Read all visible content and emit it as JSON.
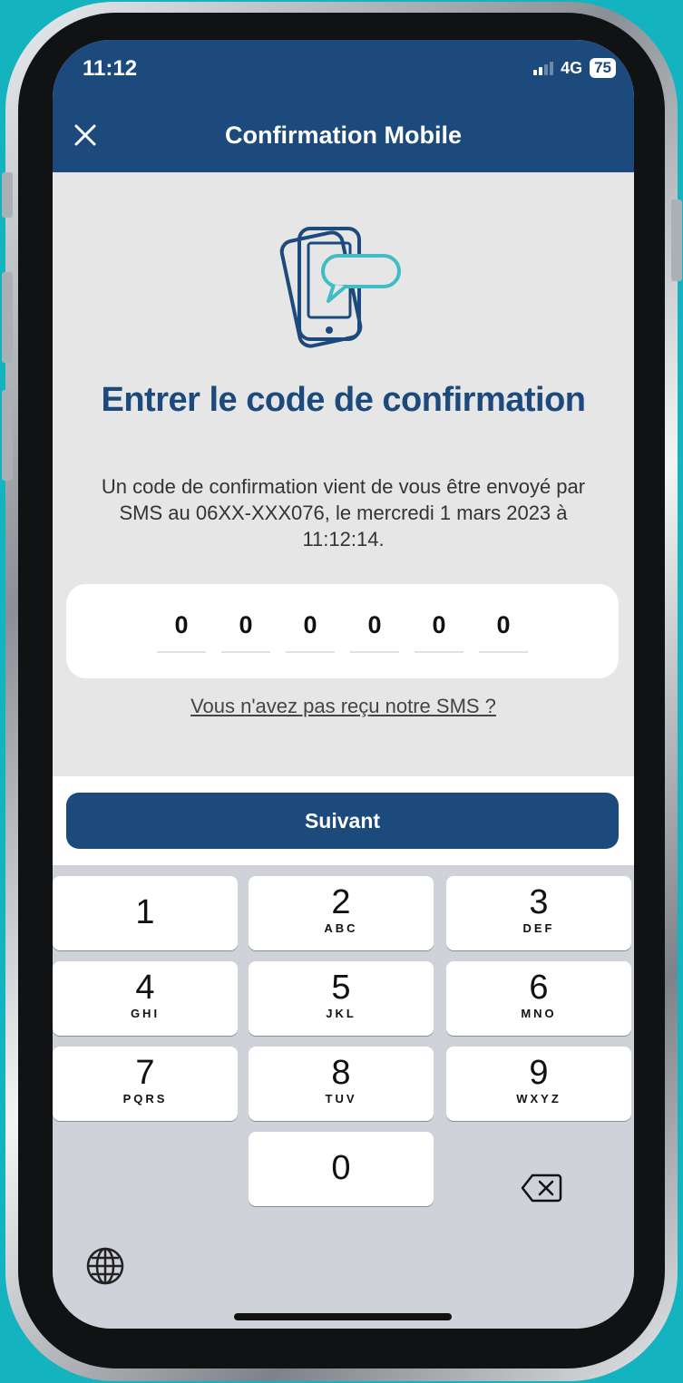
{
  "status_bar": {
    "time": "11:12",
    "network": "4G",
    "battery": "75"
  },
  "header": {
    "title": "Confirmation Mobile",
    "close_icon": "close-icon"
  },
  "main": {
    "illustration": "phone-sms-icon",
    "title": "Entrer le code de confirmation",
    "description": "Un code de confirmation vient de vous être envoyé par SMS au 06XX-XXX076, le mercredi 1 mars 2023 à 11:12:14.",
    "code_digits": [
      "0",
      "0",
      "0",
      "0",
      "0",
      "0"
    ],
    "resend_link": "Vous n'avez pas reçu notre SMS ?"
  },
  "next_button": {
    "label": "Suivant"
  },
  "keypad": {
    "keys": [
      {
        "num": "1",
        "letters": ""
      },
      {
        "num": "2",
        "letters": "ABC"
      },
      {
        "num": "3",
        "letters": "DEF"
      },
      {
        "num": "4",
        "letters": "GHI"
      },
      {
        "num": "5",
        "letters": "JKL"
      },
      {
        "num": "6",
        "letters": "MNO"
      },
      {
        "num": "7",
        "letters": "PQRS"
      },
      {
        "num": "8",
        "letters": "TUV"
      },
      {
        "num": "9",
        "letters": "WXYZ"
      },
      {
        "num": "0",
        "letters": ""
      }
    ],
    "delete_icon": "backspace-icon",
    "globe_icon": "globe-icon"
  },
  "colors": {
    "brand": "#1c4a7c",
    "accent": "#3fbcc4",
    "background": "#14b3c0"
  }
}
